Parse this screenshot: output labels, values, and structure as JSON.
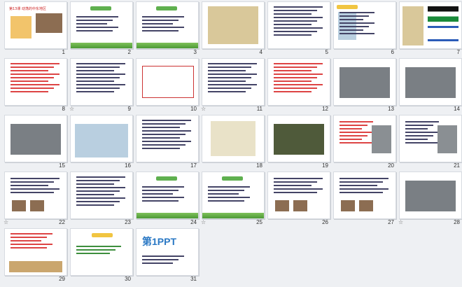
{
  "slides": [
    {
      "number": "1",
      "starred": false
    },
    {
      "number": "2",
      "starred": false
    },
    {
      "number": "3",
      "starred": false
    },
    {
      "number": "4",
      "starred": false
    },
    {
      "number": "5",
      "starred": false
    },
    {
      "number": "6",
      "starred": false
    },
    {
      "number": "7",
      "starred": false
    },
    {
      "number": "8",
      "starred": false
    },
    {
      "number": "9",
      "starred": true
    },
    {
      "number": "10",
      "starred": false
    },
    {
      "number": "11",
      "starred": true
    },
    {
      "number": "12",
      "starred": false
    },
    {
      "number": "13",
      "starred": false
    },
    {
      "number": "14",
      "starred": false
    },
    {
      "number": "15",
      "starred": false
    },
    {
      "number": "16",
      "starred": false
    },
    {
      "number": "17",
      "starred": false
    },
    {
      "number": "18",
      "starred": false
    },
    {
      "number": "19",
      "starred": false
    },
    {
      "number": "20",
      "starred": false
    },
    {
      "number": "21",
      "starred": false
    },
    {
      "number": "22",
      "starred": true
    },
    {
      "number": "23",
      "starred": false
    },
    {
      "number": "24",
      "starred": false
    },
    {
      "number": "25",
      "starred": true
    },
    {
      "number": "26",
      "starred": false
    },
    {
      "number": "27",
      "starred": false
    },
    {
      "number": "28",
      "starred": true
    },
    {
      "number": "29",
      "starred": false
    },
    {
      "number": "30",
      "starred": false
    },
    {
      "number": "31",
      "starred": false
    }
  ],
  "slide1_title": "第13课 动荡的中东地区",
  "slide31_logo": "第1PPT",
  "star_glyph": "☆"
}
